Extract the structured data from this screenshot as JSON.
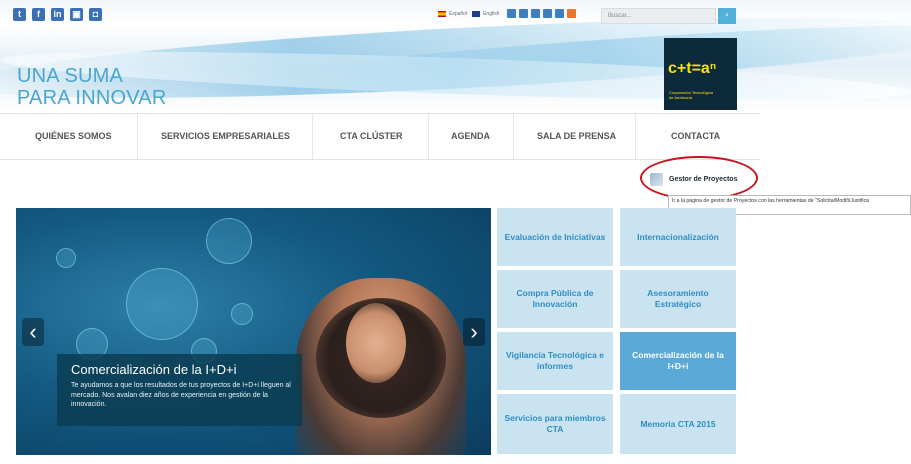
{
  "topbar": {
    "social_icons": [
      "twitter-icon",
      "facebook-icon",
      "linkedin-icon",
      "youtube-icon",
      "instagram-icon"
    ],
    "lang_es": "Español",
    "lang_en": "English",
    "search_placeholder": "Buscar...",
    "search_icon": "search-icon"
  },
  "header": {
    "tagline_line1": "UNA SUMA",
    "tagline_line2": "PARA INNOVAR",
    "logo_mark": "c+t=aⁿ",
    "logo_sub1": "Corporación Tecnológica",
    "logo_sub2": "de Andalucía"
  },
  "nav": {
    "items": [
      "QUIÉNES SOMOS",
      "SERVICIOS EMPRESARIALES",
      "CTA CLÚSTER",
      "AGENDA",
      "SALA DE PRENSA",
      "CONTACTA"
    ]
  },
  "dropdown": {
    "label": "Gestor de Proyectos",
    "tooltip": "Ir a la página de gestor de Proyectos con las herramientas de \"Solicita/Modifi/Justifica"
  },
  "slider": {
    "title": "Comercialización de la I+D+i",
    "text": "Te ayudamos a que los resultados de tus proyectos de I+D+i lleguen al mercado. Nos avalan diez años de experiencia en gestión de la innovación.",
    "prev": "‹",
    "next": "›"
  },
  "tiles": [
    {
      "label": "Evaluación de Iniciativas"
    },
    {
      "label": "Internacionalización"
    },
    {
      "label": "Compra Pública de Innovación"
    },
    {
      "label": "Asesoramiento Estratégico"
    },
    {
      "label": "Vigilancia Tecnológica e informes"
    },
    {
      "label": "Comercialización de la I+D+i"
    },
    {
      "label": "Servicios para miembros CTA"
    },
    {
      "label": "Memoria CTA 2015"
    }
  ],
  "colors": {
    "accent": "#4aa6cf",
    "highlight_oval": "#c8121e",
    "tile_light": "#c9e3f1",
    "tile_dark": "#5aa9d6"
  }
}
